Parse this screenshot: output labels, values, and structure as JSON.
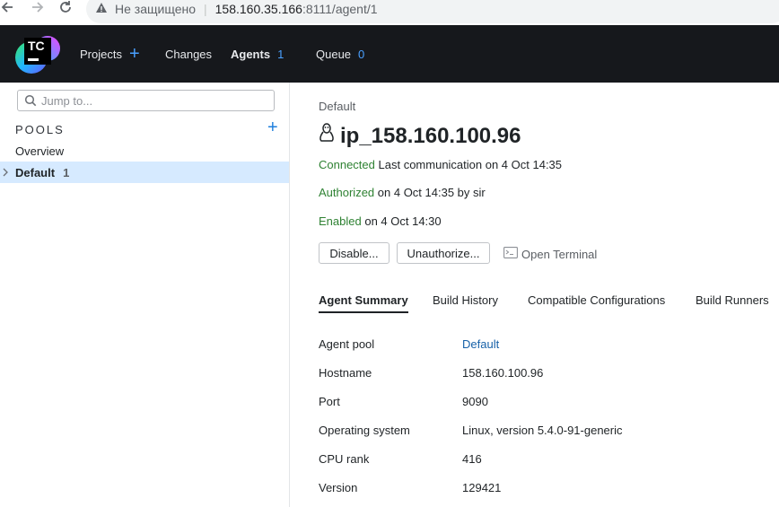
{
  "browser": {
    "insecure_label": "Не защищено",
    "url_host": "158.160.35.166",
    "url_path": ":8111/agent/1"
  },
  "header": {
    "logo_text": "TC",
    "nav": [
      {
        "label": "Projects"
      },
      {
        "label": "Changes"
      },
      {
        "label": "Agents",
        "count": "1"
      },
      {
        "label": "Queue",
        "count": "0"
      }
    ],
    "accent": "#4aa0ff",
    "background": "#16181c"
  },
  "sidebar": {
    "search_placeholder": "Jump to...",
    "pools_label": "POOLS",
    "items": [
      {
        "label": "Overview"
      },
      {
        "label": "Default",
        "count": "1",
        "selected": true
      }
    ]
  },
  "main": {
    "breadcrumb": "Default",
    "os_icon": "linux-penguin-icon",
    "agent_name": "ip_158.160.100.96",
    "status": [
      {
        "state": "Connected",
        "detail": "Last communication on 4 Oct 14:35"
      },
      {
        "state": "Authorized",
        "detail": "on 4 Oct 14:35 by sir"
      },
      {
        "state": "Enabled",
        "detail": "on 4 Oct 14:30"
      }
    ],
    "status_color": "#2f8233",
    "buttons": {
      "disable": "Disable...",
      "unauthorize": "Unauthorize...",
      "open_terminal": "Open Terminal"
    },
    "tabs": [
      "Agent Summary",
      "Build History",
      "Compatible Configurations",
      "Build Runners"
    ],
    "active_tab": "Agent Summary",
    "summary": [
      {
        "label": "Agent pool",
        "value": "Default"
      },
      {
        "label": "Hostname",
        "value": "158.160.100.96"
      },
      {
        "label": "Port",
        "value": "9090"
      },
      {
        "label": "Operating system",
        "value": "Linux, version 5.4.0-91-generic"
      },
      {
        "label": "CPU rank",
        "value": "416"
      },
      {
        "label": "Version",
        "value": "129421"
      }
    ]
  }
}
